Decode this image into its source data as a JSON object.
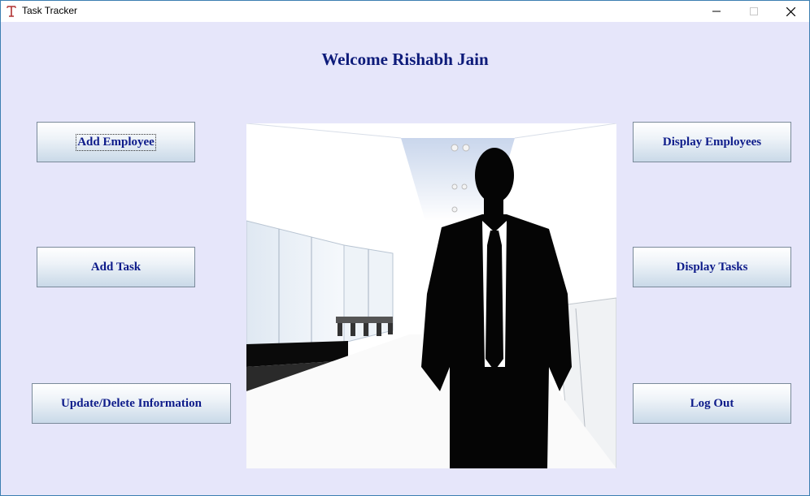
{
  "window": {
    "title": "Task Tracker",
    "icon": "app-t-icon",
    "controls": [
      "minimize-icon",
      "maximize-icon",
      "close-icon"
    ]
  },
  "welcome": "Welcome Rishabh Jain",
  "buttons": {
    "add_employee": "Add Employee",
    "add_task": "Add Task",
    "update_delete": "Update/Delete Information",
    "display_employees": "Display Employees",
    "display_tasks": "Display Tasks",
    "log_out": "Log Out"
  },
  "colors": {
    "background": "#e6e6fa",
    "button_text": "#0d1b8a",
    "welcome_text": "#0d1b7a"
  },
  "image": {
    "subject": "businessman-silhouette-in-office"
  }
}
